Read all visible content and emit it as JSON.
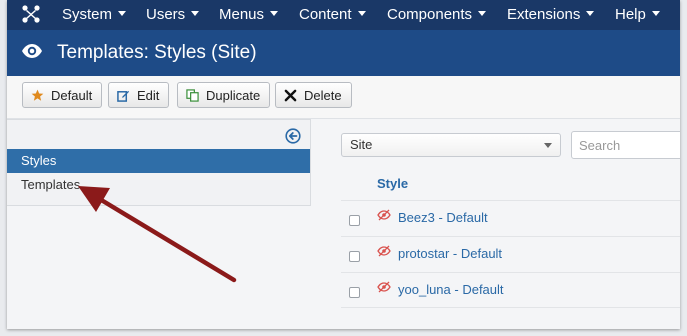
{
  "topnav": {
    "items": [
      {
        "label": "System"
      },
      {
        "label": "Users"
      },
      {
        "label": "Menus"
      },
      {
        "label": "Content"
      },
      {
        "label": "Components"
      },
      {
        "label": "Extensions"
      },
      {
        "label": "Help"
      }
    ]
  },
  "header": {
    "title": "Templates: Styles (Site)"
  },
  "toolbar": {
    "default_label": "Default",
    "edit_label": "Edit",
    "duplicate_label": "Duplicate",
    "delete_label": "Delete"
  },
  "sidebar": {
    "items": [
      {
        "label": "Styles",
        "active": true
      },
      {
        "label": "Templates",
        "active": false
      }
    ]
  },
  "filters": {
    "client_selected": "Site",
    "search_placeholder": "Search"
  },
  "table": {
    "column_header": "Style",
    "rows": [
      {
        "label": "Beez3 - Default"
      },
      {
        "label": "protostar - Default"
      },
      {
        "label": "yoo_luna - Default"
      }
    ]
  },
  "colors": {
    "topnav_bg": "#1a3867",
    "header_bg": "#1e4b87",
    "sidebar_active_bg": "#2f6ea8",
    "link": "#2a69a6",
    "annotation_arrow": "#8b1a1a",
    "hidden_icon": "#d9534f"
  },
  "icons": {
    "logo": "joomla-logo",
    "header": "eye-icon",
    "default": "star-icon",
    "edit": "edit-icon",
    "duplicate": "copy-icon",
    "delete": "close-icon",
    "collapse": "arrow-circle-left-icon",
    "row_status": "eye-hidden-icon"
  }
}
